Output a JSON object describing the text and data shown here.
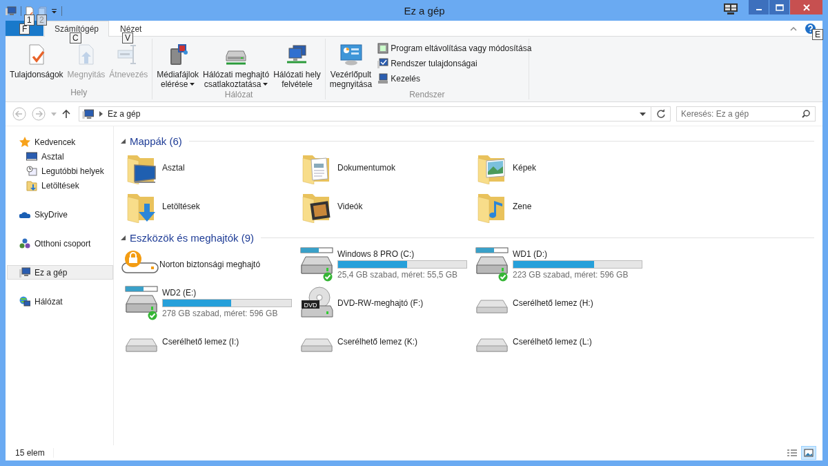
{
  "window": {
    "title": "Ez a gép"
  },
  "quick_access": [
    {
      "kind": "properties",
      "keytip": "1",
      "disabled": false
    },
    {
      "kind": "newfolder",
      "keytip": "2",
      "disabled": true
    }
  ],
  "tabs": [
    {
      "kind": "file",
      "keytip": "F",
      "selected": false
    },
    {
      "kind": "tab",
      "label": "Számítógép",
      "keytip": "C",
      "selected": true
    },
    {
      "kind": "tab",
      "label": "Nézet",
      "keytip": "V",
      "selected": false
    }
  ],
  "help": {
    "keytip": "E"
  },
  "ribbon_groups": [
    {
      "label": "Hely",
      "buttons": [
        {
          "lines": [
            "Tulajdonságok"
          ],
          "dropdown": false,
          "disabled": false
        },
        {
          "lines": [
            "Megnyitás"
          ],
          "dropdown": false,
          "disabled": true
        },
        {
          "lines": [
            "Átnevezés"
          ],
          "dropdown": false,
          "disabled": true
        }
      ]
    },
    {
      "label": "Hálózat",
      "buttons": [
        {
          "lines": [
            "Médiafájlok",
            "elérése"
          ],
          "dropdown": true,
          "disabled": false
        },
        {
          "lines": [
            "Hálózati meghajtó",
            "csatlakoztatása"
          ],
          "dropdown": true,
          "disabled": false
        },
        {
          "lines": [
            "Hálózati hely",
            "felvétele"
          ],
          "dropdown": false,
          "disabled": false
        }
      ]
    },
    {
      "label": "Rendszer",
      "buttons": [
        {
          "lines": [
            "Vezérlőpult",
            "megnyitása"
          ],
          "dropdown": false,
          "disabled": false
        }
      ],
      "small_buttons": [
        {
          "label": "Program eltávolítása vagy módosítása"
        },
        {
          "label": "Rendszer tulajdonságai"
        },
        {
          "label": "Kezelés"
        }
      ]
    }
  ],
  "address": {
    "path": "Ez a gép"
  },
  "search": {
    "placeholder": "Keresés: Ez a gép"
  },
  "sidebar": [
    {
      "label": "Kedvencek",
      "selected": false,
      "children": [
        {
          "label": "Asztal",
          "selected": false
        },
        {
          "label": "Legutóbbi helyek",
          "selected": false
        },
        {
          "label": "Letöltések",
          "selected": false
        }
      ]
    },
    {
      "label": "SkyDrive",
      "selected": false
    },
    {
      "label": "Otthoni csoport",
      "selected": false
    },
    {
      "label": "Ez a gép",
      "selected": true
    },
    {
      "label": "Hálózat",
      "selected": false
    }
  ],
  "sections": [
    {
      "title": "Mappák (6)",
      "expanded": true,
      "items": [
        {
          "kind": "folder",
          "name": "Asztal"
        },
        {
          "kind": "folder",
          "name": "Dokumentumok"
        },
        {
          "kind": "folder",
          "name": "Képek"
        },
        {
          "kind": "folder",
          "name": "Letöltések"
        },
        {
          "kind": "folder",
          "name": "Videók"
        },
        {
          "kind": "folder",
          "name": "Zene"
        }
      ]
    },
    {
      "title": "Eszközök és meghajtók (9)",
      "expanded": true,
      "items": [
        {
          "kind": "norton",
          "name": "Norton biztonsági meghajtó"
        },
        {
          "kind": "drive",
          "name": "Windows 8 PRO (C:)",
          "level": 0.54,
          "detail": "25,4 GB szabad, méret: 55,5 GB",
          "ok": true
        },
        {
          "kind": "drive",
          "name": "WD1 (D:)",
          "level": 0.63,
          "detail": "223 GB szabad, méret: 596 GB",
          "ok": true
        },
        {
          "kind": "drive",
          "name": "WD2 (E:)",
          "level": 0.53,
          "detail": "278 GB szabad, méret: 596 GB",
          "ok": true
        },
        {
          "kind": "dvd",
          "name": "DVD-RW-meghajtó (F:)",
          "icon_label": "DVD"
        },
        {
          "kind": "removable",
          "name": "Cserélhető lemez (H:)"
        },
        {
          "kind": "removable",
          "name": "Cserélhető lemez (I:)"
        },
        {
          "kind": "removable",
          "name": "Cserélhető lemez (K:)"
        },
        {
          "kind": "removable",
          "name": "Cserélhető lemez (L:)"
        }
      ]
    }
  ],
  "status_bar": {
    "count": "15 elem",
    "views": [
      {
        "kind": "details",
        "selected": false
      },
      {
        "kind": "large",
        "selected": true
      }
    ]
  }
}
